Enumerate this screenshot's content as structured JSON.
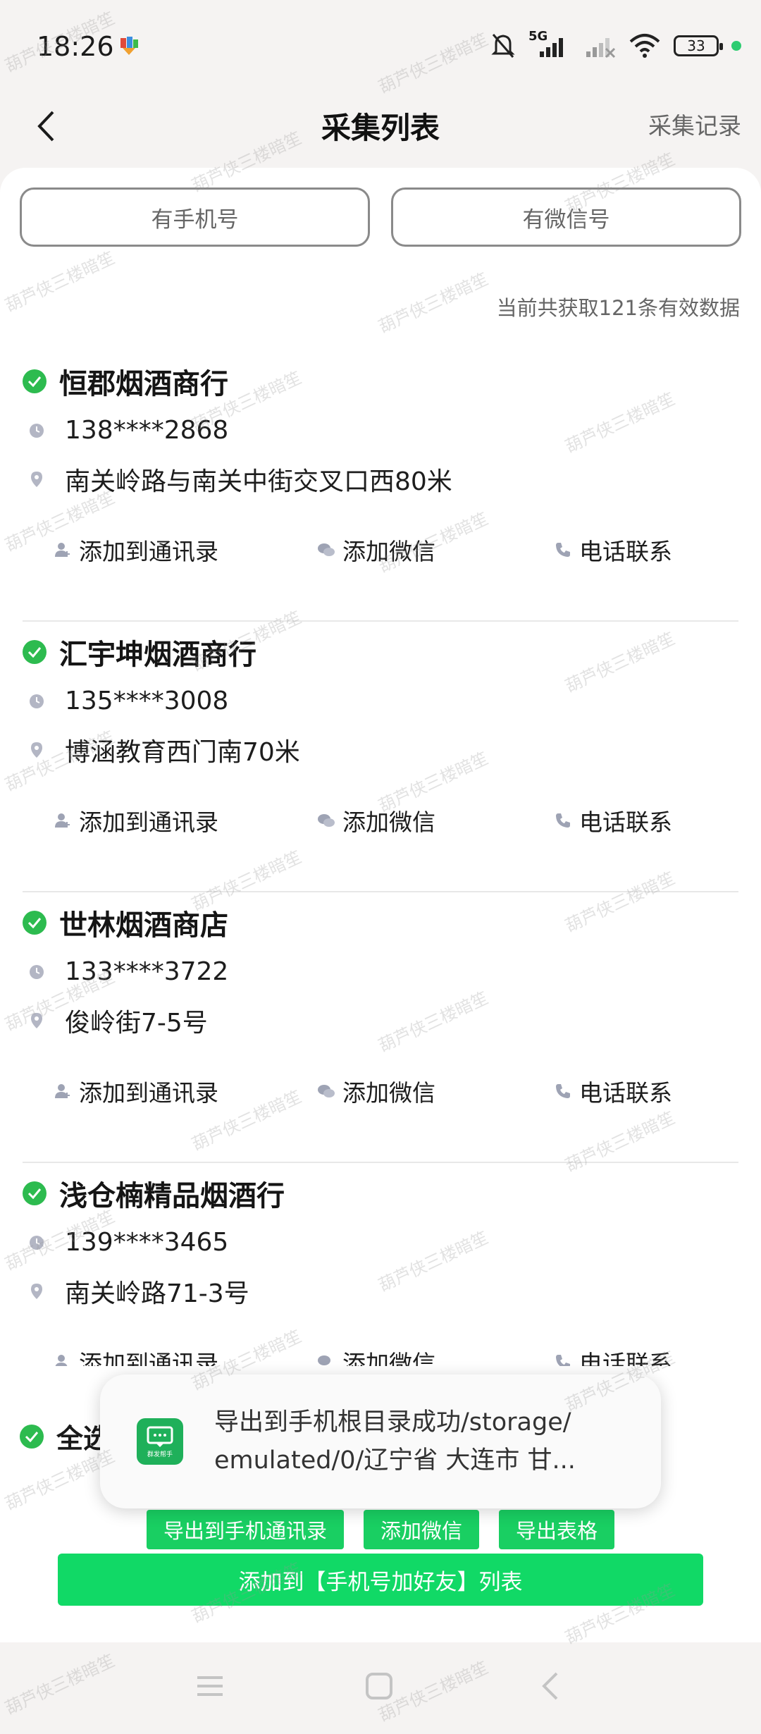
{
  "status_bar": {
    "time": "18:26",
    "battery": "33",
    "network": "5G"
  },
  "header": {
    "title": "采集列表",
    "record_link": "采集记录"
  },
  "filters": [
    "有手机号",
    "有微信号"
  ],
  "summary": "当前共获取121条有效数据",
  "items": [
    {
      "name": "恒郡烟酒商行",
      "phone": "138****2868",
      "address": "南关岭路与南关中街交叉口西80米"
    },
    {
      "name": "汇宇坤烟酒商行",
      "phone": "135****3008",
      "address": "博涵教育西门南70米"
    },
    {
      "name": "世林烟酒商店",
      "phone": "133****3722",
      "address": "俊岭街7-5号"
    },
    {
      "name": "浅仓楠精品烟酒行",
      "phone": "139****3465",
      "address": "南关岭路71-3号"
    }
  ],
  "item_actions": {
    "add_contact": "添加到通讯录",
    "add_wechat": "添加微信",
    "call": "电话联系"
  },
  "select_all": "全选",
  "bottom_actions": [
    "导出到手机通讯录",
    "添加微信",
    "导出表格"
  ],
  "primary_action": "添加到【手机号加好友】列表",
  "toast": {
    "line1": "导出到手机根目录成功/storage/",
    "line2": "emulated/0/辽宁省 大连市 甘...",
    "app_label": "群发帮手"
  },
  "watermark": "葫芦侠三楼暗笙",
  "colors": {
    "accent": "#11d966",
    "check": "#2dbb4f"
  }
}
